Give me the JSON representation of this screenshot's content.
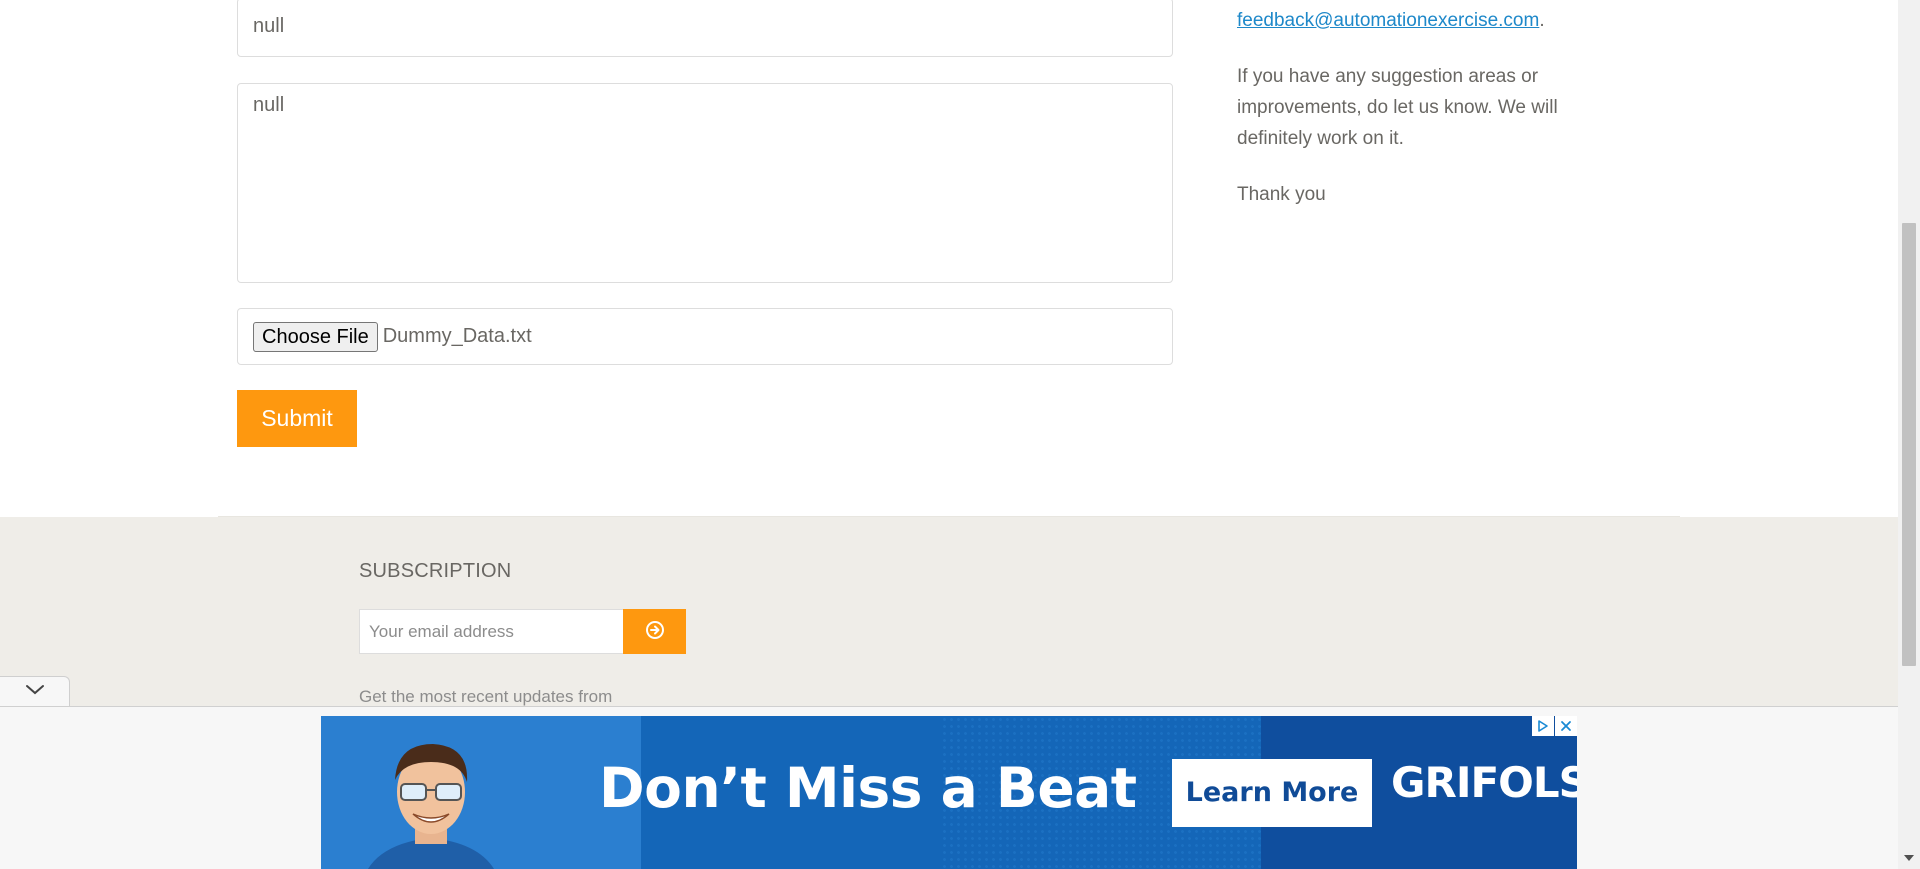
{
  "form": {
    "subject_value": "null",
    "message_value": "null",
    "file_button_label": "Choose File",
    "file_name": "Dummy_Data.txt",
    "submit_label": "Submit"
  },
  "contact_info": {
    "email_link": "feedback@automationexercise.com",
    "email_suffix": ".",
    "suggestion_text": "If you have any suggestion areas or improvements, do let us know. We will definitely work on it.",
    "thanks_text": "Thank you"
  },
  "footer": {
    "subscription_title": "SUBSCRIPTION",
    "email_placeholder": "Your email address",
    "updates_text": "Get the most recent updates from",
    "subscribe_icon": "arrow-circle-right-icon"
  },
  "ad": {
    "headline": "Don’t Miss a Beat",
    "cta_label": "Learn More",
    "brand": "GRIFOLS"
  },
  "colors": {
    "accent": "#fe980f",
    "link": "#1e88c9",
    "footer_bg": "#efede8",
    "ad_blue": "#1466b8"
  }
}
